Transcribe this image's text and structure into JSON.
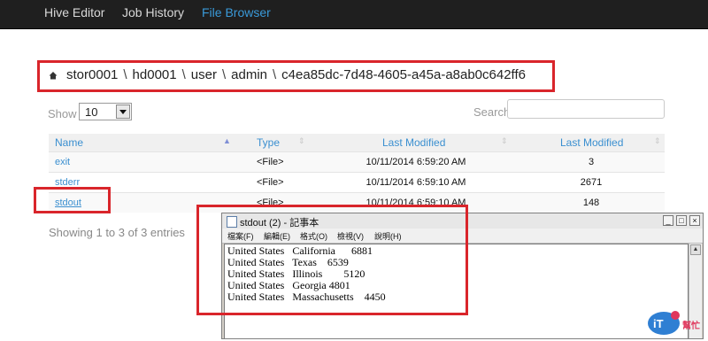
{
  "nav": {
    "items": [
      {
        "label": "Hive Editor",
        "active": false
      },
      {
        "label": "Job History",
        "active": false
      },
      {
        "label": "File Browser",
        "active": true
      }
    ]
  },
  "breadcrumb": {
    "parts": [
      "stor0001",
      "hd0001",
      "user",
      "admin",
      "c4ea85dc-7d48-4605-a45a-a8ab0c642ff6"
    ],
    "separator": "\\"
  },
  "controls": {
    "show_label": "Show",
    "show_value": "10",
    "search_label": "Search",
    "search_value": ""
  },
  "table": {
    "headers": [
      "Name",
      "Type",
      "Last Modified",
      "Last Modified"
    ],
    "rows": [
      {
        "name": "exit",
        "type": "<File>",
        "modified": "10/11/2014 6:59:20 AM",
        "size": "3"
      },
      {
        "name": "stderr",
        "type": "<File>",
        "modified": "10/11/2014 6:59:10 AM",
        "size": "2671"
      },
      {
        "name": "stdout",
        "type": "<File>",
        "modified": "10/11/2014 6:59:10 AM",
        "size": "148"
      }
    ]
  },
  "info": "Showing 1 to 3 of 3 entries",
  "notepad": {
    "title": "stdout (2) - 記事本",
    "menu": [
      "檔案(F)",
      "編輯(E)",
      "格式(O)",
      "檢視(V)",
      "說明(H)"
    ],
    "content": "United States   California      6881\nUnited States   Texas    6539\nUnited States   Illinois        5120\nUnited States   Georgia 4801\nUnited States   Massachusetts    4450"
  },
  "watermark": {
    "text": "幫忙"
  },
  "colors": {
    "accent": "#3a9ad9",
    "highlight": "#d9252b",
    "navbar": "#1f1f1f"
  }
}
